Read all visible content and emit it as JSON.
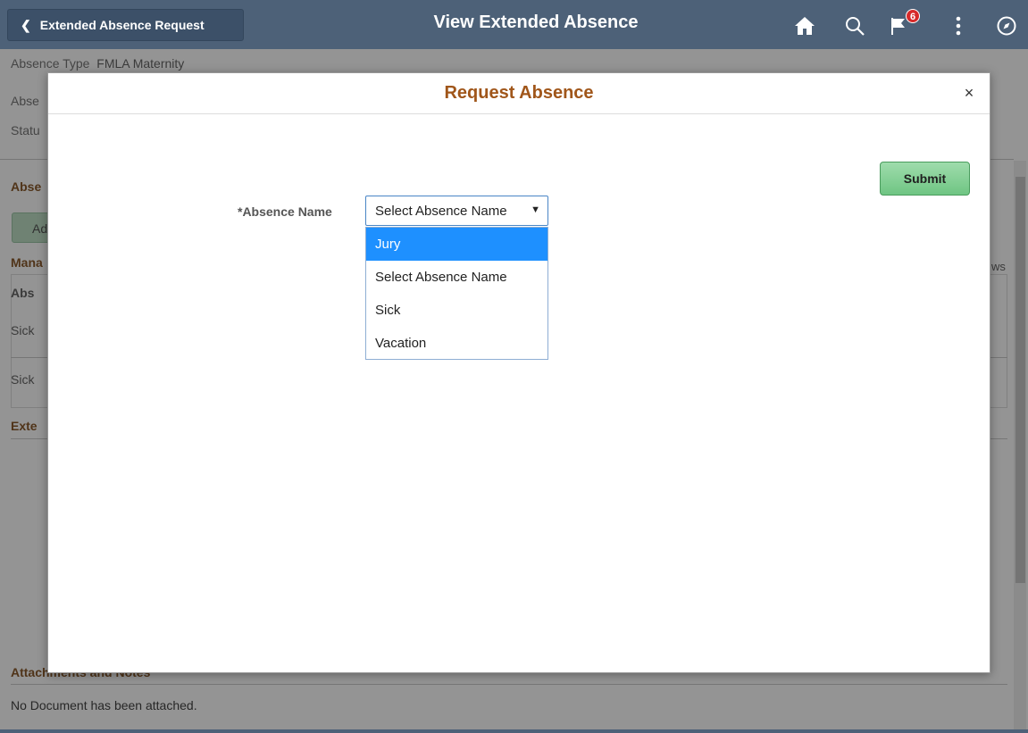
{
  "header": {
    "back_label": "Extended Absence Request",
    "title": "View Extended Absence",
    "notification_count": "6",
    "icons": [
      "home-icon",
      "search-icon",
      "flag-icon",
      "more-icon",
      "navbar-icon"
    ]
  },
  "background": {
    "absence_type_label": "Absence Type",
    "absence_type_value": "FMLA Maternity",
    "row2_label": "Abse",
    "status_label": "Statu",
    "section_absence": "Abse",
    "add_button": "Ad",
    "section_manage": "Mana",
    "rows_label": "ws",
    "table_header": "Abs",
    "table_rows": [
      "Sick",
      "Sick"
    ],
    "section_extended": "Exte",
    "attachments_title": "Attachments and Notes",
    "no_document": "No Document has been attached."
  },
  "modal": {
    "title": "Request Absence",
    "close": "×",
    "submit_label": "Submit",
    "absence_name_label": "*Absence Name",
    "select_value": "Select Absence Name",
    "options": [
      "Jury",
      "Select Absence Name",
      "Sick",
      "Vacation"
    ],
    "highlighted_option": "Jury"
  },
  "colors": {
    "header_bg": "#4d6178",
    "modal_title": "#a0561a",
    "submit_green": "#6fc583",
    "option_highlight": "#1e90ff"
  }
}
